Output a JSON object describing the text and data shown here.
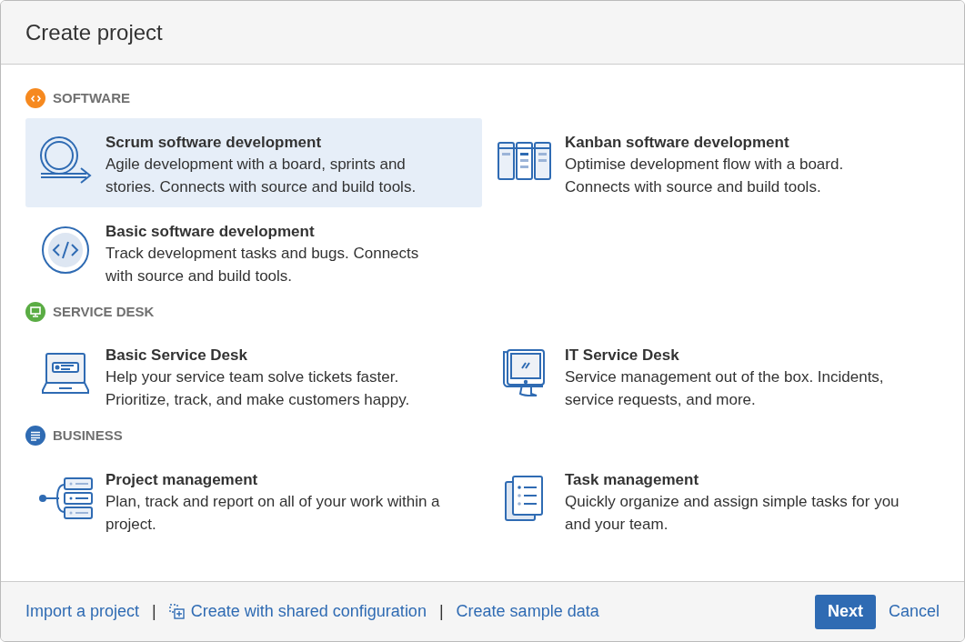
{
  "dialog": {
    "title": "Create project"
  },
  "sections": [
    {
      "title": "SOFTWARE",
      "kind": "code",
      "color": "#f6891f",
      "items": [
        {
          "kind": "scrum",
          "title": "Scrum software development",
          "description": "Agile development with a board, sprints and stories. Connects with source and build tools.",
          "selected": true
        },
        {
          "kind": "kanban",
          "title": "Kanban software development",
          "description": "Optimise development flow with a board. Connects with source and build tools.",
          "selected": false
        },
        {
          "kind": "code",
          "title": "Basic software development",
          "description": "Track development tasks and bugs. Connects with source and build tools.",
          "selected": false
        }
      ]
    },
    {
      "title": "SERVICE DESK",
      "kind": "monitor",
      "color": "#5aac44",
      "items": [
        {
          "kind": "laptop",
          "title": "Basic Service Desk",
          "description": "Help your service team solve tickets faster. Prioritize, track, and make customers happy.",
          "selected": false
        },
        {
          "kind": "imac",
          "title": "IT Service Desk",
          "description": "Service management out of the box. Incidents, service requests, and more.",
          "selected": false
        }
      ]
    },
    {
      "title": "BUSINESS",
      "kind": "list",
      "color": "#2f6bb3",
      "items": [
        {
          "kind": "tree",
          "title": "Project management",
          "description": "Plan, track and report on all of your work within a project.",
          "selected": false
        },
        {
          "kind": "tasks",
          "title": "Task management",
          "description": "Quickly organize and assign simple tasks for you and your team.",
          "selected": false
        }
      ]
    }
  ],
  "footer": {
    "links": [
      {
        "kind": "link",
        "label": "Import a project"
      },
      {
        "kind": "separator",
        "label": "|"
      },
      {
        "kind": "icon_link",
        "label": "Create with shared configuration"
      },
      {
        "kind": "separator",
        "label": "|"
      },
      {
        "kind": "link",
        "label": "Create sample data"
      }
    ],
    "primary_button": "Next",
    "cancel": "Cancel"
  }
}
